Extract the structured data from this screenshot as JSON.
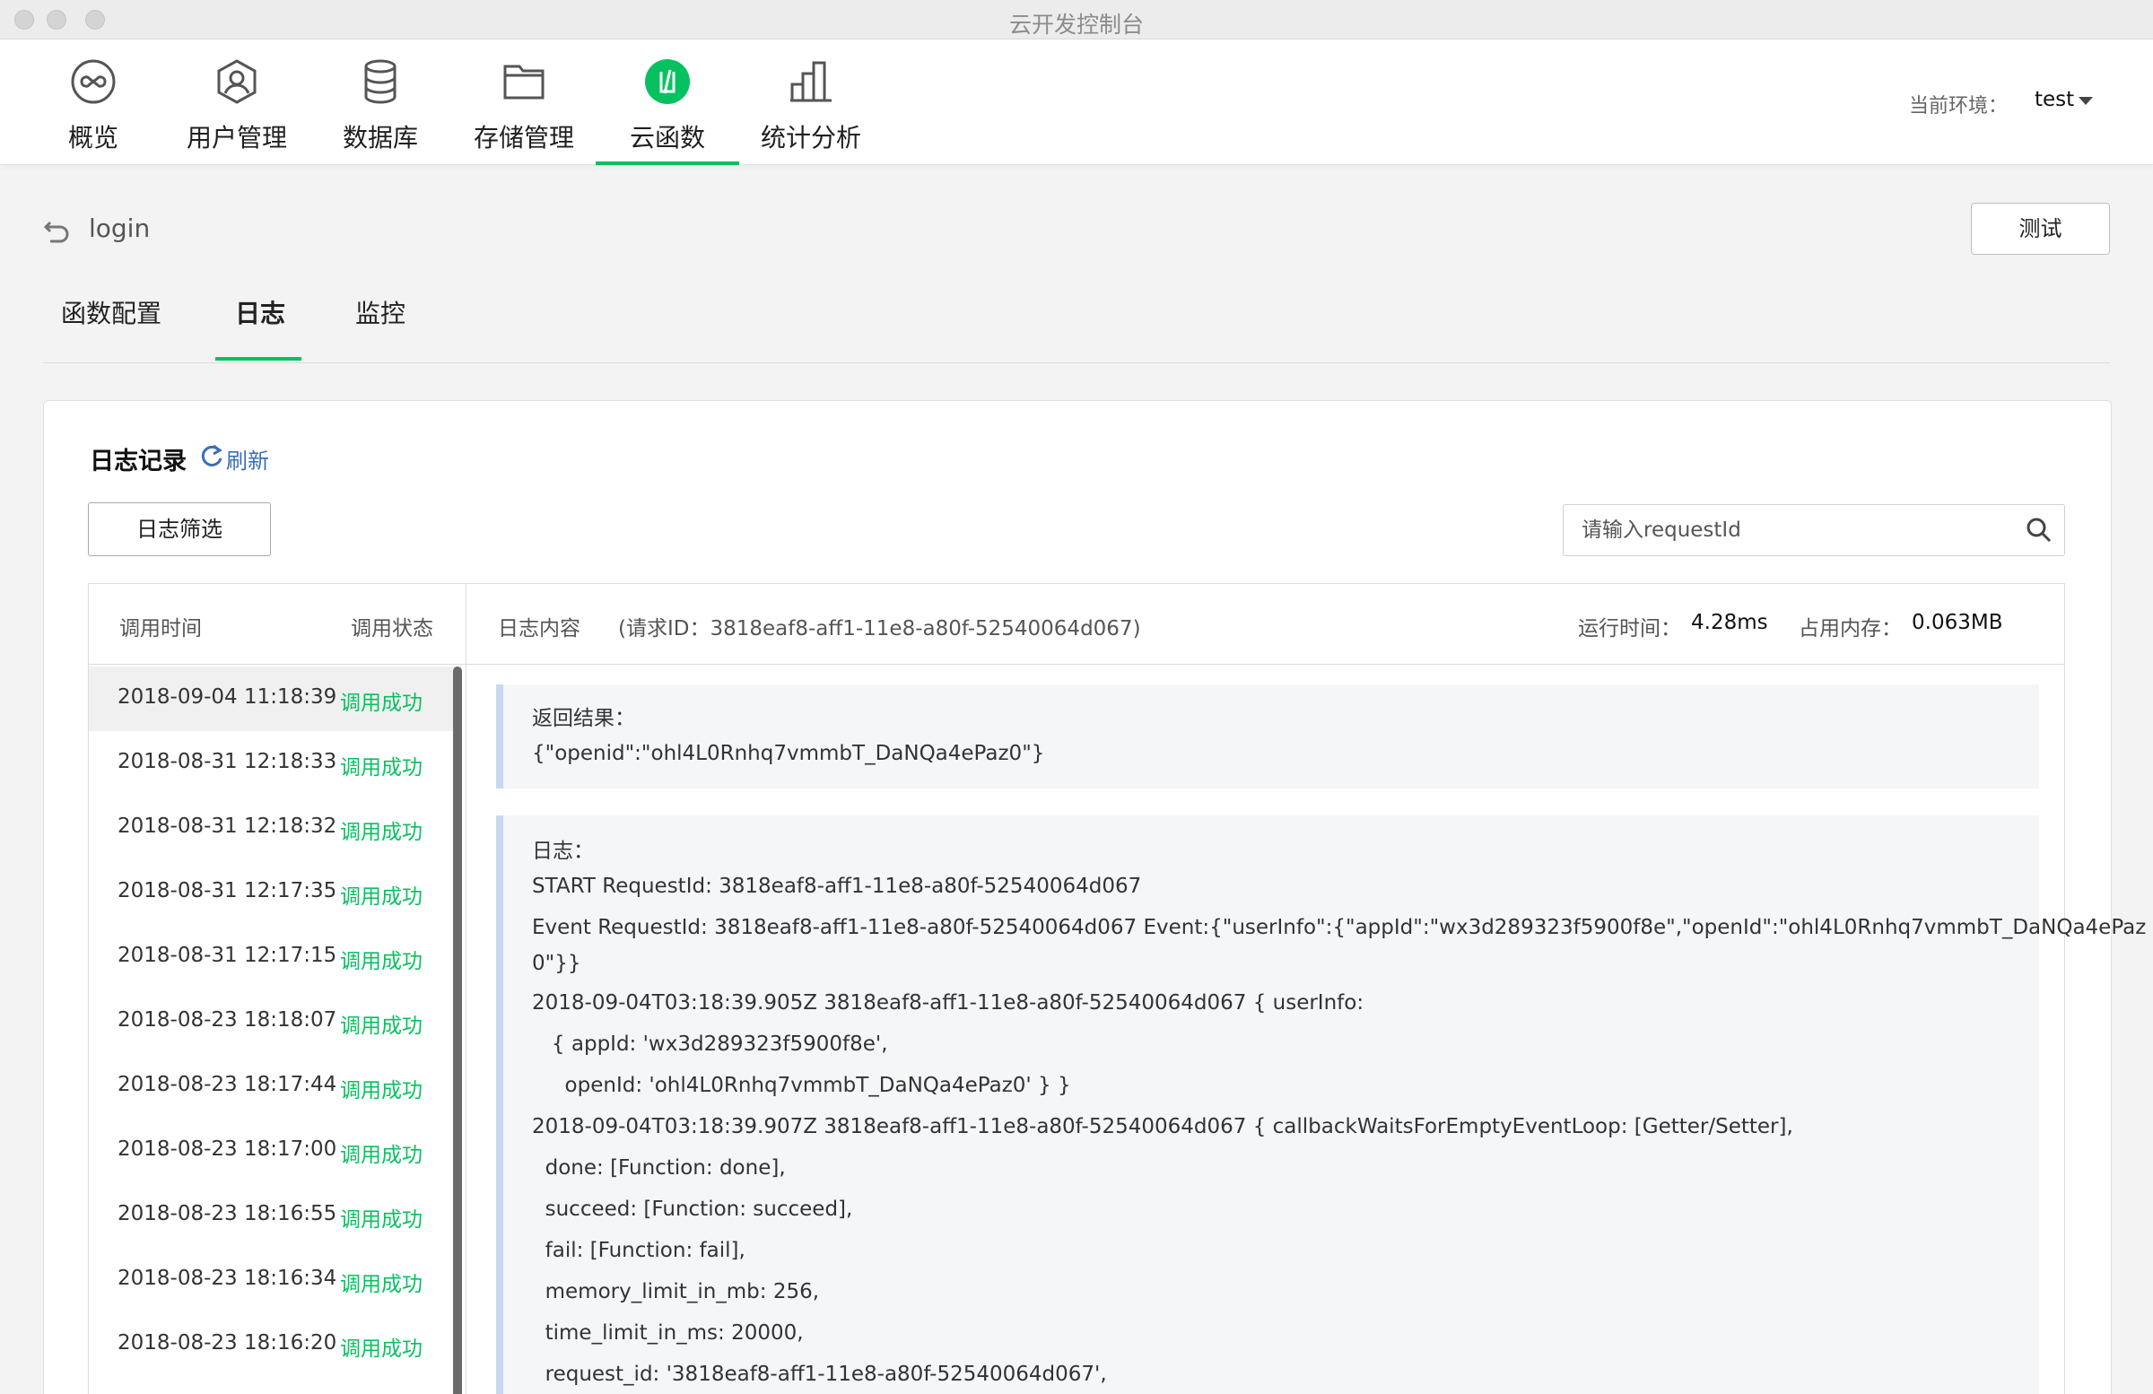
{
  "window": {
    "title": "云开发控制台"
  },
  "nav": {
    "items": [
      {
        "label": "概览",
        "icon": "overview-infinity-icon"
      },
      {
        "label": "用户管理",
        "icon": "user-icon"
      },
      {
        "label": "数据库",
        "icon": "database-icon"
      },
      {
        "label": "存储管理",
        "icon": "storage-folder-icon"
      },
      {
        "label": "云函数",
        "icon": "cloud-function-icon",
        "active": true
      },
      {
        "label": "统计分析",
        "icon": "statistics-icon"
      }
    ],
    "env_label": "当前环境：",
    "env_value": "test"
  },
  "function": {
    "name": "login",
    "test_label": "测试"
  },
  "tabs": [
    {
      "label": "函数配置"
    },
    {
      "label": "日志",
      "active": true
    },
    {
      "label": "监控"
    }
  ],
  "logs": {
    "title": "日志记录",
    "refresh_label": "刷新",
    "filter_label": "日志筛选",
    "search_placeholder": "请输入requestId",
    "header": {
      "col_time": "调用时间",
      "col_status": "调用状态",
      "content_label": "日志内容",
      "request_id": "(请求ID：3818eaf8-aff1-11e8-a80f-52540064d067)",
      "runtime_label": "运行时间：",
      "runtime_value": "4.28ms",
      "memory_label": "占用内存：",
      "memory_value": "0.063MB"
    },
    "rows": [
      {
        "time": "2018-09-04 11:18:39",
        "status": "调用成功",
        "selected": true
      },
      {
        "time": "2018-08-31 12:18:33",
        "status": "调用成功"
      },
      {
        "time": "2018-08-31 12:18:32",
        "status": "调用成功"
      },
      {
        "time": "2018-08-31 12:17:35",
        "status": "调用成功"
      },
      {
        "time": "2018-08-31 12:17:15",
        "status": "调用成功"
      },
      {
        "time": "2018-08-23 18:18:07",
        "status": "调用成功"
      },
      {
        "time": "2018-08-23 18:17:44",
        "status": "调用成功"
      },
      {
        "time": "2018-08-23 18:17:00",
        "status": "调用成功"
      },
      {
        "time": "2018-08-23 18:16:55",
        "status": "调用成功"
      },
      {
        "time": "2018-08-23 18:16:34",
        "status": "调用成功"
      },
      {
        "time": "2018-08-23 18:16:20",
        "status": "调用成功"
      }
    ],
    "result_block": {
      "title": "返回结果：",
      "lines": [
        "{\"openid\":\"ohl4L0Rnhq7vmmbT_DaNQa4ePaz0\"}"
      ]
    },
    "log_block": {
      "title": "日志：",
      "lines": [
        "START RequestId: 3818eaf8-aff1-11e8-a80f-52540064d067",
        "Event RequestId: 3818eaf8-aff1-11e8-a80f-52540064d067 Event:{\"userInfo\":{\"appId\":\"wx3d289323f5900f8e\",\"openId\":\"ohl4L0Rnhq7vmmbT_DaNQa4ePaz",
        "0\"}}",
        "2018-09-04T03:18:39.905Z 3818eaf8-aff1-11e8-a80f-52540064d067 { userInfo:",
        "   { appId: 'wx3d289323f5900f8e',",
        "     openId: 'ohl4L0Rnhq7vmmbT_DaNQa4ePaz0' } }",
        "2018-09-04T03:18:39.907Z 3818eaf8-aff1-11e8-a80f-52540064d067 { callbackWaitsForEmptyEventLoop: [Getter/Setter],",
        "  done: [Function: done],",
        "  succeed: [Function: succeed],",
        "  fail: [Function: fail],",
        "  memory_limit_in_mb: 256,",
        "  time_limit_in_ms: 20000,",
        "  request_id: '3818eaf8-aff1-11e8-a80f-52540064d067',"
      ]
    }
  },
  "colors": {
    "accent": "#07c160",
    "link": "#3b6fb6",
    "block_border": "#c7d9f1"
  }
}
